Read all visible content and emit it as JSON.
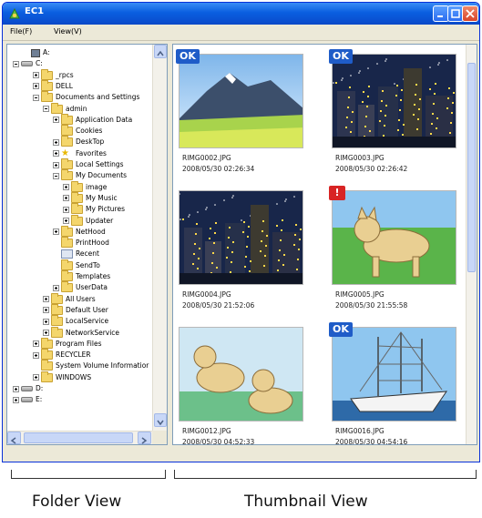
{
  "window": {
    "title": "EC1"
  },
  "menu": {
    "file": "File(F)",
    "view": "View(V)"
  },
  "tree": [
    {
      "label": "A:",
      "icon": "floppy",
      "pm": "blank",
      "indent": 1
    },
    {
      "label": "C:",
      "icon": "drive",
      "pm": "minus",
      "indent": 0
    },
    {
      "label": "_rpcs",
      "icon": "folder",
      "pm": "plus",
      "indent": 2
    },
    {
      "label": "DELL",
      "icon": "folder",
      "pm": "plus",
      "indent": 2
    },
    {
      "label": "Documents and Settings",
      "icon": "folder",
      "pm": "minus",
      "indent": 2
    },
    {
      "label": "admin",
      "icon": "folder",
      "pm": "minus",
      "indent": 3
    },
    {
      "label": "Application Data",
      "icon": "folder",
      "pm": "plus",
      "indent": 4
    },
    {
      "label": "Cookies",
      "icon": "folder",
      "pm": "blank",
      "indent": 4
    },
    {
      "label": "DeskTop",
      "icon": "folder",
      "pm": "plus",
      "indent": 4
    },
    {
      "label": "Favorites",
      "icon": "star",
      "pm": "plus",
      "indent": 4
    },
    {
      "label": "Local Settings",
      "icon": "folder",
      "pm": "plus",
      "indent": 4
    },
    {
      "label": "My Documents",
      "icon": "folder",
      "pm": "minus",
      "indent": 4
    },
    {
      "label": "image",
      "icon": "folder",
      "pm": "plus",
      "indent": 5
    },
    {
      "label": "My Music",
      "icon": "folder",
      "pm": "plus",
      "indent": 5
    },
    {
      "label": "My Pictures",
      "icon": "folder",
      "pm": "plus",
      "indent": 5
    },
    {
      "label": "Updater",
      "icon": "folder",
      "pm": "plus",
      "indent": 5
    },
    {
      "label": "NetHood",
      "icon": "folder",
      "pm": "plus",
      "indent": 4
    },
    {
      "label": "PrintHood",
      "icon": "folder",
      "pm": "blank",
      "indent": 4
    },
    {
      "label": "Recent",
      "icon": "special",
      "pm": "blank",
      "indent": 4
    },
    {
      "label": "SendTo",
      "icon": "folder",
      "pm": "blank",
      "indent": 4
    },
    {
      "label": "Templates",
      "icon": "folder",
      "pm": "blank",
      "indent": 4
    },
    {
      "label": "UserData",
      "icon": "folder",
      "pm": "plus",
      "indent": 4
    },
    {
      "label": "All Users",
      "icon": "folder",
      "pm": "plus",
      "indent": 3
    },
    {
      "label": "Default User",
      "icon": "folder",
      "pm": "plus",
      "indent": 3
    },
    {
      "label": "LocalService",
      "icon": "folder",
      "pm": "plus",
      "indent": 3
    },
    {
      "label": "NetworkService",
      "icon": "folder",
      "pm": "plus",
      "indent": 3
    },
    {
      "label": "Program Files",
      "icon": "folder",
      "pm": "plus",
      "indent": 2
    },
    {
      "label": "RECYCLER",
      "icon": "folder",
      "pm": "plus",
      "indent": 2
    },
    {
      "label": "System Volume Informatior",
      "icon": "folder",
      "pm": "blank",
      "indent": 2
    },
    {
      "label": "WINDOWS",
      "icon": "folder",
      "pm": "plus",
      "indent": 2
    },
    {
      "label": "D:",
      "icon": "drive",
      "pm": "plus",
      "indent": 0
    },
    {
      "label": "E:",
      "icon": "drive",
      "pm": "plus",
      "indent": 0
    }
  ],
  "thumbnails": [
    {
      "name": "RIMG0002.JPG",
      "date": "2008/05/30 02:26:34",
      "badge": "OK",
      "scene": "mountain"
    },
    {
      "name": "RIMG0003.JPG",
      "date": "2008/05/30 02:26:42",
      "badge": "OK",
      "scene": "city"
    },
    {
      "name": "RIMG0004.JPG",
      "date": "2008/05/30 21:52:06",
      "badge": "",
      "scene": "city"
    },
    {
      "name": "RIMG0005.JPG",
      "date": "2008/05/30 21:55:58",
      "badge": "!",
      "scene": "dog"
    },
    {
      "name": "RIMG0012.JPG",
      "date": "2008/05/30 04:52:33",
      "badge": "",
      "scene": "dogs"
    },
    {
      "name": "RIMG0016.JPG",
      "date": "2008/05/30 04:54:16",
      "badge": "OK",
      "scene": "ship"
    }
  ],
  "annotations": {
    "folder_view": "Folder View",
    "thumbnail_view": "Thumbnail View"
  },
  "colors": {
    "titlebar": "#0a5fe0",
    "badge_ok": "#1f5cc8",
    "badge_warn": "#d82424"
  }
}
